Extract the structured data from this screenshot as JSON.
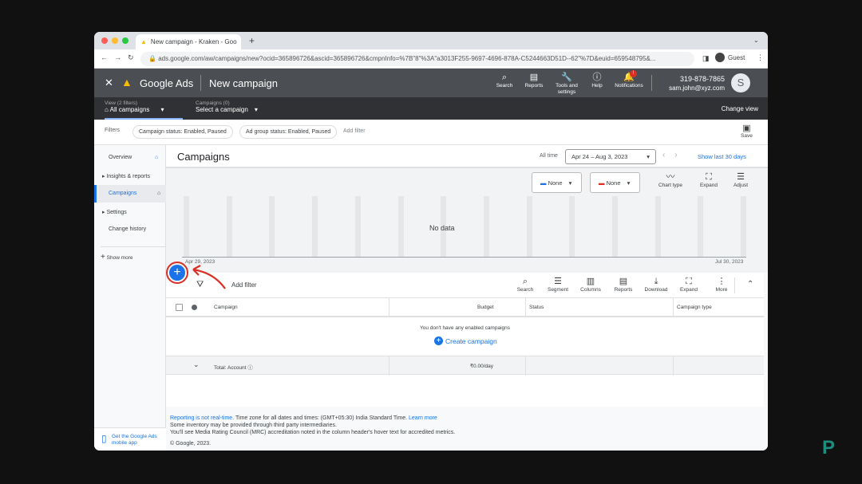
{
  "browser": {
    "tab_title": "New campaign - Kraken - Goo",
    "url": "ads.google.com/aw/campaigns/new?ocid=365896726&ascid=365896726&cmpnInfo=%7B\"8\"%3A\"a3013F255-9697-4696-878A-C5244663D51D--62\"%7D&euid=659548795&...",
    "profile": "Guest"
  },
  "header": {
    "product": "Google Ads",
    "page_title": "New campaign",
    "search": "Search",
    "reports": "Reports",
    "tools": "Tools and settings",
    "help": "Help",
    "notifications": "Notifications",
    "notif_badge": "!",
    "phone": "319-878-7865",
    "email": "sam.john@xyz.com",
    "avatar": "S"
  },
  "subheader": {
    "view_label": "View (2 filters)",
    "view_value": "All campaigns",
    "campaigns_label": "Campaigns (0)",
    "campaigns_value": "Select a campaign",
    "change_view": "Change view"
  },
  "filters": {
    "label": "Filters",
    "chips": [
      "Campaign status: Enabled, Paused",
      "Ad group status: Enabled, Paused"
    ],
    "add": "Add filter",
    "save": "Save"
  },
  "sidebar": {
    "items": [
      "Overview",
      "Insights & reports",
      "Campaigns",
      "Settings",
      "Change history"
    ],
    "show_more": "Show more",
    "app_promo": "Get the Google Ads mobile app"
  },
  "main": {
    "title": "Campaigns",
    "all_time": "All time",
    "date_range": "Apr 24 – Aug 3, 2023",
    "show_last": "Show last 30 days"
  },
  "chart": {
    "metric1": "None",
    "metric2": "None",
    "chart_type": "Chart type",
    "expand": "Expand",
    "adjust": "Adjust",
    "no_data": "No data",
    "x_start": "Apr 29, 2023",
    "x_end": "Jul 30, 2023",
    "color1": "#1a73e8",
    "color2": "#d93025"
  },
  "table": {
    "add_filter": "Add filter",
    "tools": [
      "Search",
      "Segment",
      "Columns",
      "Reports",
      "Download",
      "Expand",
      "More"
    ],
    "columns": [
      "Campaign",
      "Budget",
      "Status",
      "Campaign type"
    ],
    "empty": "You don't have any enabled campaigns",
    "create": "Create campaign",
    "total_label": "Total: Account",
    "total_budget": "₹0.00/day"
  },
  "footer": {
    "link1": "Reporting is not real-time.",
    "line1": " Time zone for all dates and times: (GMT+05:30) India Standard Time. ",
    "link2": "Learn more",
    "line2": "Some inventory may be provided through third party intermediaries.",
    "line3": "You'll see Media Rating Council (MRC) accreditation noted in the column header's hover text for accredited metrics.",
    "copyright": "© Google, 2023."
  }
}
